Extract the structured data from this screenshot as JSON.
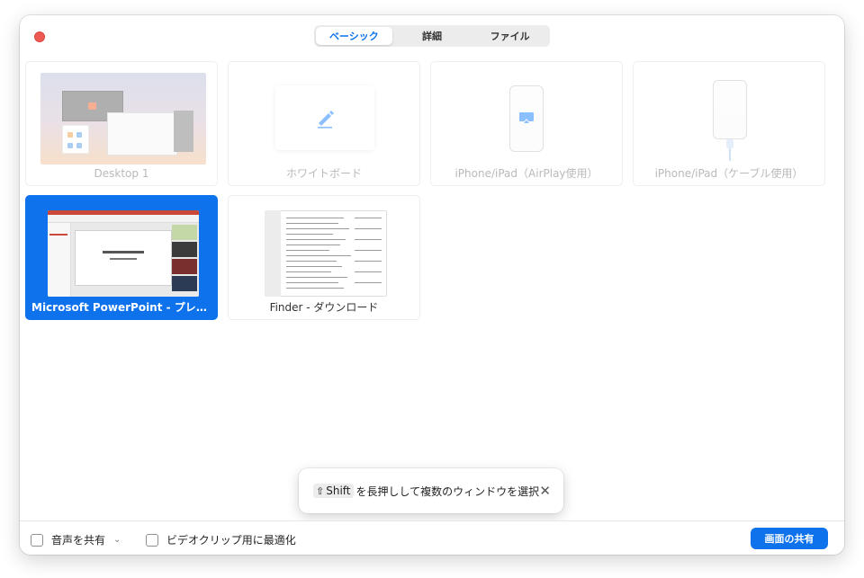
{
  "tabs": [
    {
      "label": "ベーシック",
      "active": true
    },
    {
      "label": "詳細",
      "active": false
    },
    {
      "label": "ファイル",
      "active": false
    }
  ],
  "sources": [
    {
      "label": "Desktop 1",
      "kind": "desktop",
      "state": "dim"
    },
    {
      "label": "ホワイトボード",
      "kind": "whiteboard",
      "state": "dim"
    },
    {
      "label": "iPhone/iPad（AirPlay使用）",
      "kind": "airplay",
      "state": "dim"
    },
    {
      "label": "iPhone/iPad（ケーブル使用）",
      "kind": "cable",
      "state": "dim"
    },
    {
      "label": "Microsoft PowerPoint - プレゼンテ…",
      "kind": "powerpoint-window",
      "state": "selected"
    },
    {
      "label": "Finder - ダウンロード",
      "kind": "finder-window",
      "state": "normal"
    }
  ],
  "toast": {
    "key": "Shift",
    "text": "を長押しして複数のウィンドウを選択"
  },
  "footer": {
    "audio_label": "音声を共有",
    "video_label": "ビデオクリップ用に最適化",
    "share_label": "画面の共有"
  },
  "colors": {
    "accent": "#0e72ed",
    "close": "#ee5a52"
  },
  "icons": [
    "close-dot-icon",
    "pencil-icon",
    "airplay-icon",
    "lightning-cable-icon",
    "shift-icon",
    "close-icon",
    "chevron-down-icon"
  ]
}
